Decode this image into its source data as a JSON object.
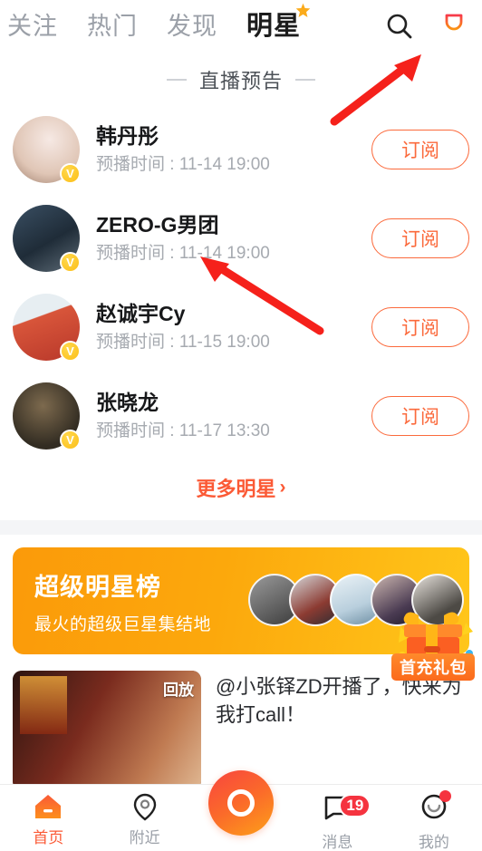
{
  "topbar": {
    "tabs": [
      {
        "label": "关注",
        "active": false
      },
      {
        "label": "热门",
        "active": false
      },
      {
        "label": "发现",
        "active": false
      },
      {
        "label": "明星",
        "active": true
      }
    ],
    "icons": {
      "search": "search-icon",
      "rank": "trophy-icon"
    }
  },
  "section": {
    "title": "直播预告"
  },
  "stars": [
    {
      "name": "韩丹彤",
      "time": "预播时间 : 11-14 19:00",
      "button": "订阅",
      "verified": "V",
      "avatar_colors": [
        "#efe3dd",
        "#c9a98f"
      ]
    },
    {
      "name": "ZERO-G男团",
      "time": "预播时间 : 11-14 19:00",
      "button": "订阅",
      "verified": "V",
      "avatar_colors": [
        "#2b3a4a",
        "#6d7b86"
      ]
    },
    {
      "name": "赵诚宇Cy",
      "time": "预播时间 : 11-15 19:00",
      "button": "订阅",
      "verified": "V",
      "avatar_colors": [
        "#dfe6ea",
        "#d8553a"
      ]
    },
    {
      "name": "张晓龙",
      "time": "预播时间 : 11-17 13:30",
      "button": "订阅",
      "verified": "V",
      "avatar_colors": [
        "#2e2a22",
        "#8d7a5d"
      ]
    }
  ],
  "more_link": {
    "label": "更多明星",
    "chevron": "›"
  },
  "banner": {
    "title": "超级明星榜",
    "subtitle": "最火的超级巨星集结地",
    "faces": 5,
    "gradient_from": "#fb9a0a",
    "gradient_to": "#ffc61a"
  },
  "gift_float": {
    "label": "首充礼包"
  },
  "feed": {
    "replay_badge": "回放",
    "text": "@小张铎ZD开播了，快来为我打call！"
  },
  "tabbar": {
    "items": [
      {
        "label": "首页",
        "icon": "home-icon",
        "active": true,
        "badge": "",
        "dot": false
      },
      {
        "label": "附近",
        "icon": "location-pin-icon",
        "active": false,
        "badge": "",
        "dot": false
      },
      {
        "label": "消息",
        "icon": "message-bubble-icon",
        "active": false,
        "badge": "19",
        "dot": false
      },
      {
        "label": "我的",
        "icon": "profile-face-icon",
        "active": false,
        "badge": "",
        "dot": true
      }
    ],
    "center": {
      "name": "record-button"
    }
  },
  "colors": {
    "accent": "#fb5a36",
    "subscribe": "#fb6a3c",
    "badge_red": "#f5333f",
    "verified_gold": "#fcbe16",
    "muted": "#9ba0a8"
  }
}
